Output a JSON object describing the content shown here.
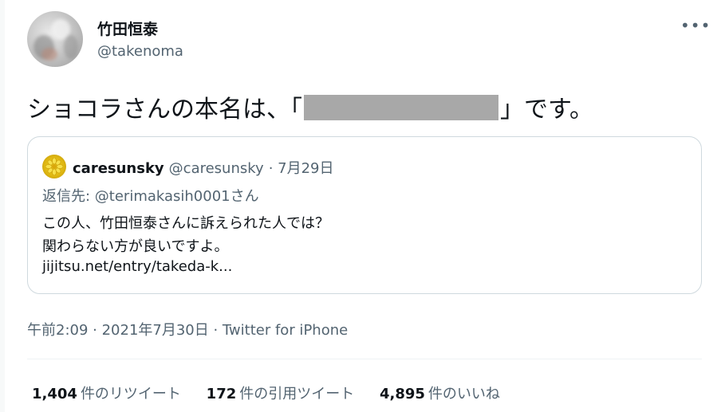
{
  "author": {
    "display_name": "竹田恒泰",
    "handle": "@takenoma"
  },
  "tweet": {
    "text_before": "ショコラさんの本名は、「",
    "text_after": "」です。",
    "timestamp": "午前2:09 · 2021年7月30日 · Twitter for iPhone"
  },
  "quote": {
    "display_name": "caresunsky",
    "handle": "@caresunsky",
    "date": "· 7月29日",
    "reply_to": "返信先: @terimakasih0001さん",
    "lines": [
      "この人、竹田恒泰さんに訴えられた人では？",
      "関わらない方が良いですよ。",
      "jijitsu.net/entry/takeda-k..."
    ]
  },
  "stats": [
    {
      "count": "1,404",
      "label": "件のリツイート"
    },
    {
      "count": "172",
      "label": "件の引用ツイート"
    },
    {
      "count": "4,895",
      "label": "件のいいね"
    }
  ],
  "icons": {
    "more": "more-options-icon"
  },
  "colors": {
    "text_primary": "#0f1419",
    "text_secondary": "#536471",
    "border": "#cfd9de",
    "redaction": "#a8a8a8"
  }
}
